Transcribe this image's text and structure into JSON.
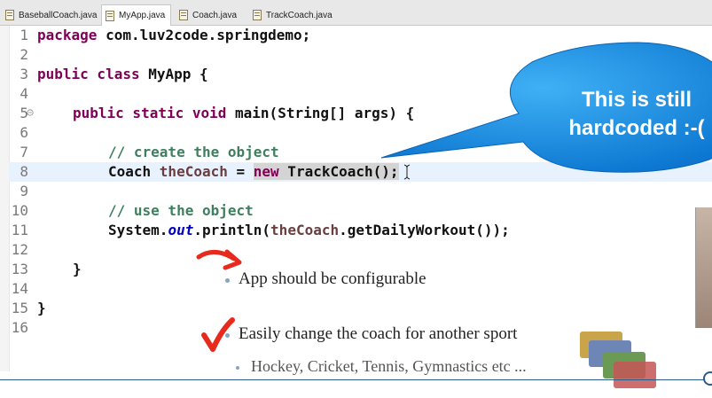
{
  "tabs": [
    {
      "label": "BaseballCoach.java",
      "active": false
    },
    {
      "label": "MyApp.java",
      "active": true
    },
    {
      "label": "Coach.java",
      "active": false
    },
    {
      "label": "TrackCoach.java",
      "active": false
    }
  ],
  "editor": {
    "line_numbers": [
      "1",
      "2",
      "3",
      "4",
      "5",
      "6",
      "7",
      "8",
      "9",
      "10",
      "11",
      "12",
      "13",
      "14",
      "15",
      "16"
    ],
    "code": {
      "l1_kw": "package",
      "l1_rest": " com.luv2code.springdemo;",
      "l3_kw": "public class",
      "l3_rest": " MyApp {",
      "l5_kw": "public static void",
      "l5_rest": " main(String[] args) {",
      "l7": "// create the object",
      "l8_a": "Coach ",
      "l8_b": "theCoach",
      "l8_c": " = ",
      "l8_kw": "new",
      "l8_d": " TrackCoach();",
      "l10": "// use the object",
      "l11_a": "System.",
      "l11_b": "out",
      "l11_c": ".println(",
      "l11_d": "theCoach",
      "l11_e": ".getDailyWorkout());",
      "l13": "}",
      "l15": "}"
    }
  },
  "callout": {
    "line1": "This is still",
    "line2": "hardcoded :-(",
    "color": "#1e8ee0"
  },
  "bullets": {
    "b1": "App should be configurable",
    "b2": "Easily change the coach for another sport",
    "b3": "Hockey, Cricket, Tennis, Gymnastics etc ..."
  },
  "icons": {
    "arrow": "red-curved-arrow-icon",
    "check": "red-checkmark-icon",
    "cards": "stacked-cards-icon"
  }
}
